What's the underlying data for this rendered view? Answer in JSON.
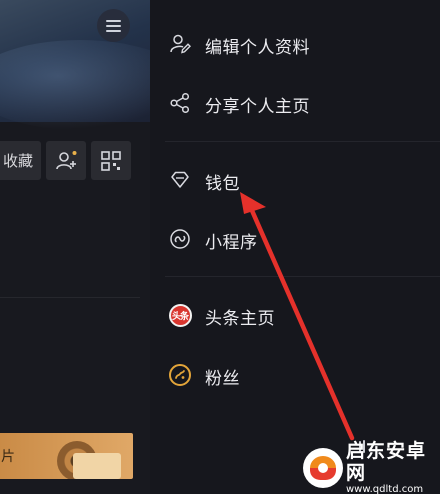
{
  "left_page": {
    "favorites_label": "收藏",
    "card_label": "片"
  },
  "drawer": {
    "items": [
      {
        "label": "编辑个人资料",
        "icon": "edit-profile-icon"
      },
      {
        "label": "分享个人主页",
        "icon": "share-icon"
      },
      {
        "label": "钱包",
        "icon": "diamond-wallet-icon"
      },
      {
        "label": "小程序",
        "icon": "mini-program-icon"
      },
      {
        "label": "头条主页",
        "icon": "toutiao-logo-icon",
        "icon_text": "头条"
      },
      {
        "label": "粉丝",
        "icon": "fans-icon"
      }
    ]
  },
  "colors": {
    "background": "#16171d",
    "text": "#ececf0",
    "annotation_arrow": "#e5312b",
    "toutiao_red": "#d9362f",
    "fans_gold": "#e3a53a"
  },
  "watermark": {
    "title": "启东安卓网",
    "url": "www.qdltd.com"
  }
}
